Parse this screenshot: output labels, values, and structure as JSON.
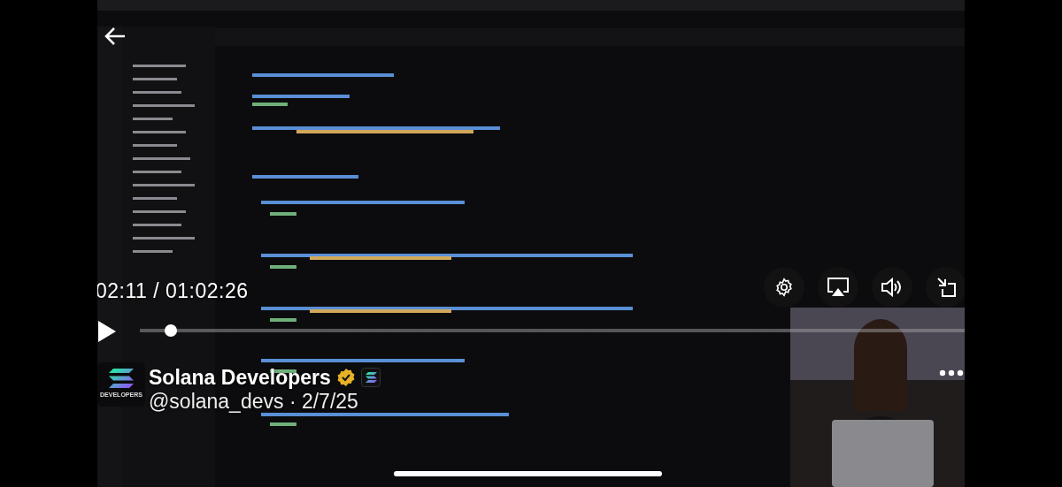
{
  "player": {
    "elapsed": "02:11",
    "separator": "/",
    "duration": "01:02:26",
    "playing": false
  },
  "channel": {
    "avatar_caption": "DEVELOPERS",
    "name": "Solana Developers",
    "verified": true,
    "handle": "@solana_devs · 2/7/25"
  }
}
